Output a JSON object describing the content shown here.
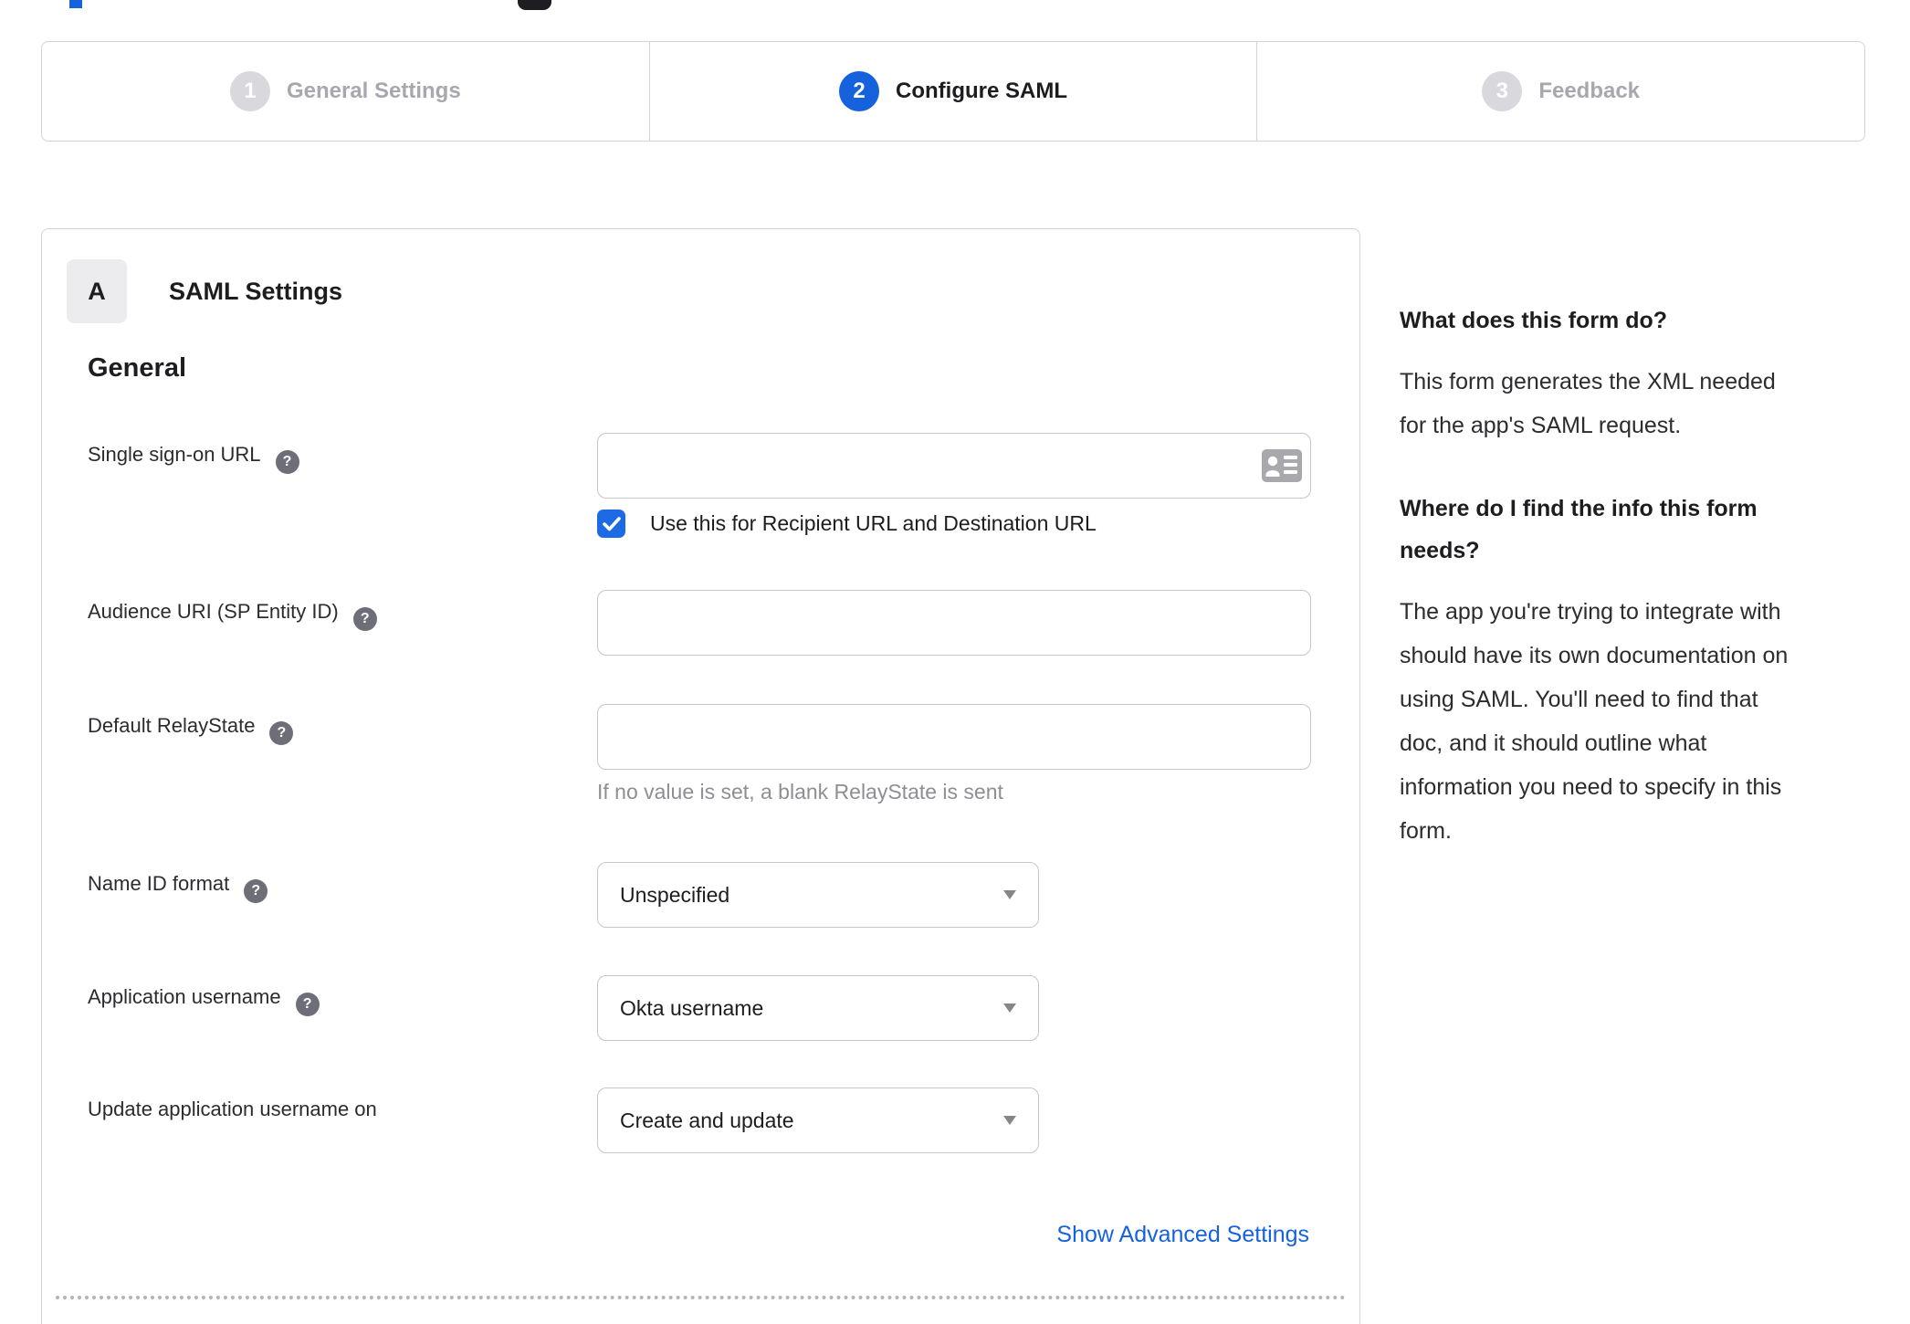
{
  "colors": {
    "accent": "#1662dd",
    "checkbox": "#1c6ae4",
    "inactive_step": "#d8d8dd",
    "border": "#d4d4d8"
  },
  "stepper": {
    "steps": [
      {
        "number": "1",
        "label": "General Settings",
        "active": false
      },
      {
        "number": "2",
        "label": "Configure SAML",
        "active": true
      },
      {
        "number": "3",
        "label": "Feedback",
        "active": false
      }
    ]
  },
  "panel": {
    "badge": "A",
    "title": "SAML Settings",
    "section_heading": "General"
  },
  "form": {
    "sso": {
      "label": "Single sign-on URL",
      "value": "",
      "checkbox_label": "Use this for Recipient URL and Destination URL",
      "checkbox_checked": true
    },
    "audience": {
      "label": "Audience URI (SP Entity ID)",
      "value": ""
    },
    "relay": {
      "label": "Default RelayState",
      "value": "",
      "hint": "If no value is set, a blank RelayState is sent"
    },
    "name_id": {
      "label": "Name ID format",
      "value": "Unspecified"
    },
    "app_user": {
      "label": "Application username",
      "value": "Okta username"
    },
    "update_user": {
      "label": "Update application username on",
      "value": "Create and update"
    },
    "advanced_link_label": "Show Advanced Settings",
    "help_icon_glyph": "?"
  },
  "sidebar": {
    "heading1": "What does this form do?",
    "para1": "This form generates the XML needed\nfor the app's SAML request.",
    "heading2": "Where do I find the info this form\nneeds?",
    "para2": "The app you're trying to integrate with\nshould have its own documentation on\nusing SAML. You'll need to find that\ndoc, and it should outline what\ninformation you need to specify in this\nform."
  }
}
